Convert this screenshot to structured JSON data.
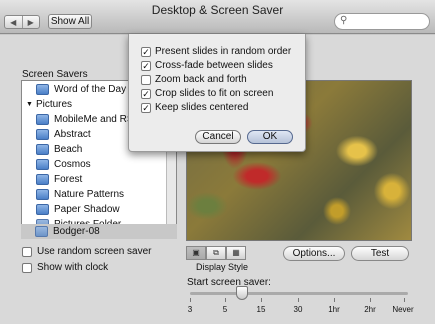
{
  "window": {
    "title": "Desktop & Screen Saver"
  },
  "toolbar": {
    "back_icon": "chevron-left-icon",
    "forward_icon": "chevron-right-icon",
    "show_all_label": "Show All",
    "search_placeholder": ""
  },
  "screen_savers": {
    "label": "Screen Savers",
    "items": [
      {
        "label": "Word of the Day",
        "icon": "screen-saver-icon",
        "type": "item"
      },
      {
        "label": "Pictures",
        "icon": "disclosure-triangle-icon",
        "type": "group"
      },
      {
        "label": "MobileMe and RSS",
        "icon": "screen-saver-icon",
        "type": "item"
      },
      {
        "label": "Abstract",
        "icon": "screen-saver-icon",
        "type": "item"
      },
      {
        "label": "Beach",
        "icon": "screen-saver-icon",
        "type": "item"
      },
      {
        "label": "Cosmos",
        "icon": "screen-saver-icon",
        "type": "item"
      },
      {
        "label": "Forest",
        "icon": "screen-saver-icon",
        "type": "item"
      },
      {
        "label": "Nature Patterns",
        "icon": "screen-saver-icon",
        "type": "item"
      },
      {
        "label": "Paper Shadow",
        "icon": "screen-saver-icon",
        "type": "item"
      },
      {
        "label": "Pictures Folder",
        "icon": "folder-icon",
        "type": "item"
      },
      {
        "label": "Bodger-08",
        "icon": "folder-icon",
        "type": "item",
        "selected": true
      }
    ]
  },
  "options": {
    "random_label": "Use random screen saver",
    "random_checked": false,
    "clock_label": "Show with clock",
    "clock_checked": false
  },
  "preview": {
    "display_style_label": "Display Style",
    "options_button": "Options...",
    "test_button": "Test"
  },
  "start": {
    "label": "Start screen saver:",
    "ticks": [
      "3",
      "5",
      "15",
      "30",
      "1hr",
      "2hr",
      "Never"
    ],
    "selected": "10"
  },
  "sheet": {
    "options": [
      {
        "label": "Present slides in random order",
        "checked": true
      },
      {
        "label": "Cross-fade between slides",
        "checked": true
      },
      {
        "label": "Zoom back and forth",
        "checked": false
      },
      {
        "label": "Crop slides to fit on screen",
        "checked": true
      },
      {
        "label": "Keep slides centered",
        "checked": true
      }
    ],
    "cancel_label": "Cancel",
    "ok_label": "OK"
  },
  "colors": {
    "default_button": "#b6c3d9",
    "selection": "#c8c8c8"
  }
}
